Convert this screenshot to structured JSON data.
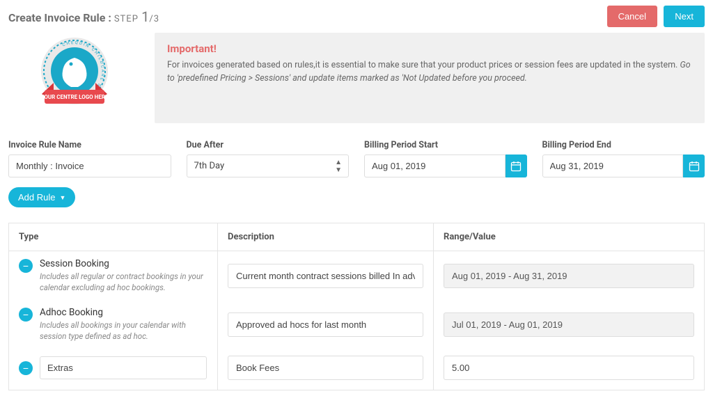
{
  "page": {
    "title_prefix": "Create Invoice Rule :",
    "step_label": " STEP ",
    "step_current": "1",
    "step_sep": "/",
    "step_total": "3"
  },
  "buttons": {
    "cancel": "Cancel",
    "next": "Next",
    "add_rule": "Add Rule"
  },
  "logo": {
    "ring_text": "CHEQDIN   CHILDCARE   SOFTWARE",
    "banner_text": "YOUR CENTRE LOGO HERE"
  },
  "important": {
    "heading": "Important!",
    "body_plain": "For invoices generated based on rules,it is essential to make sure that your product prices or session fees are updated in the system. ",
    "body_italic": "Go to 'predefined Pricing > Sessions' and update items marked as 'Not Updated before you proceed."
  },
  "fields": {
    "name": {
      "label": "Invoice Rule Name",
      "value": "Monthly : Invoice"
    },
    "due_after": {
      "label": "Due After",
      "value": "7th Day"
    },
    "start": {
      "label": "Billing Period Start",
      "value": "Aug 01, 2019"
    },
    "end": {
      "label": "Billing Period End",
      "value": "Aug 31, 2019"
    }
  },
  "table": {
    "headers": {
      "type": "Type",
      "description": "Description",
      "range": "Range/Value"
    },
    "rows": [
      {
        "type_title": "Session Booking",
        "type_sub": "Includes all regular or contract bookings in your calendar excluding ad hoc bookings.",
        "description": "Current month contract sessions billed In advance",
        "range": "Aug 01, 2019 - Aug 31, 2019",
        "range_readonly": true
      },
      {
        "type_title": "Adhoc Booking",
        "type_sub": "Includes all bookings in your calendar with session type defined as ad hoc.",
        "description": "Approved ad hocs for last month",
        "range": "Jul 01, 2019 - Aug 01, 2019",
        "range_readonly": true
      },
      {
        "type_title": "Extras",
        "type_sub": "",
        "description": "Book Fees",
        "range": "5.00",
        "range_readonly": false
      }
    ]
  }
}
